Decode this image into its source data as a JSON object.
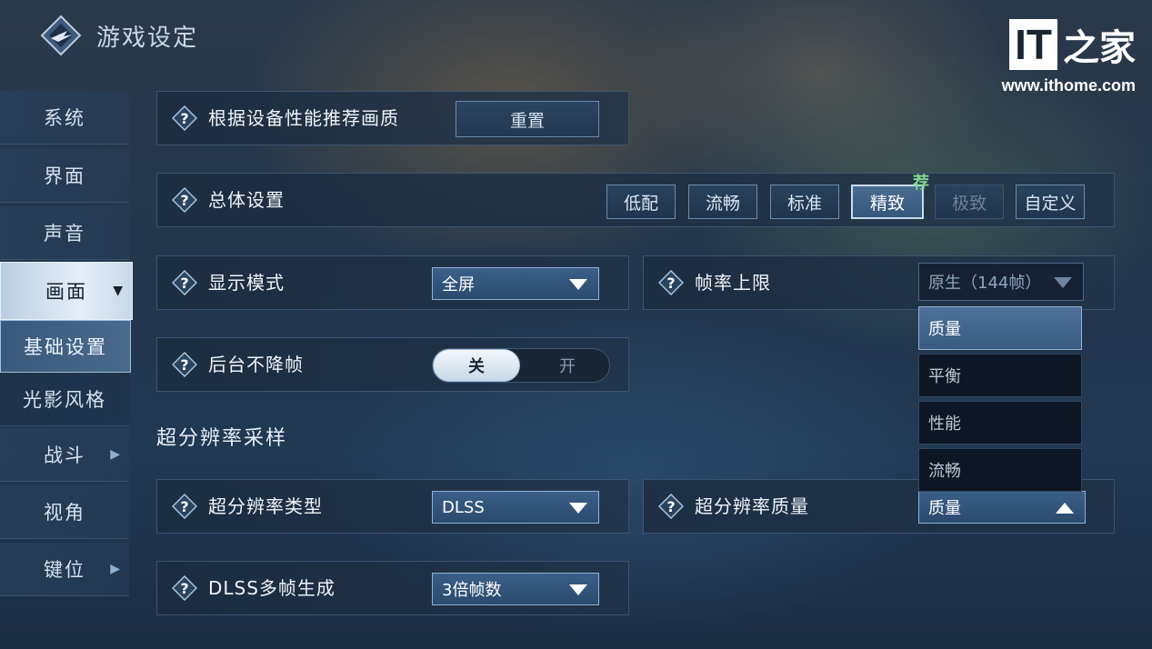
{
  "header": {
    "title": "游戏设定"
  },
  "watermark": {
    "logo_it": "IT",
    "logo_home": "之家",
    "url": "www.ithome.com"
  },
  "sidebar": {
    "items": [
      {
        "label": "系统"
      },
      {
        "label": "界面"
      },
      {
        "label": "声音"
      },
      {
        "label": "画面"
      },
      {
        "label": "基础设置"
      },
      {
        "label": "光影风格"
      },
      {
        "label": "战斗"
      },
      {
        "label": "视角"
      },
      {
        "label": "键位"
      }
    ]
  },
  "recommend": {
    "label": "根据设备性能推荐画质",
    "button": "重置"
  },
  "overall": {
    "label": "总体设置",
    "presets": [
      "低配",
      "流畅",
      "标准",
      "精致",
      "极致",
      "自定义"
    ],
    "selected": "精致",
    "recommended_badge": "荐"
  },
  "display_mode": {
    "label": "显示模式",
    "value": "全屏"
  },
  "fps_limit": {
    "label": "帧率上限",
    "current": "原生（144帧）",
    "options": [
      "质量",
      "平衡",
      "性能",
      "流畅"
    ],
    "highlighted": "质量"
  },
  "background_fps": {
    "label": "后台不降帧",
    "off_label": "关",
    "on_label": "开",
    "state": "关"
  },
  "upscaling": {
    "section_title": "超分辨率采样",
    "type_label": "超分辨率类型",
    "type_value": "DLSS",
    "quality_label": "超分辨率质量",
    "quality_value": "质量",
    "framegen_label": "DLSS多帧生成",
    "framegen_value": "3倍帧数"
  },
  "colors": {
    "accent": "#8fb2d6",
    "selected_item": "#4e719a",
    "recommend_badge": "#7fd68f"
  }
}
